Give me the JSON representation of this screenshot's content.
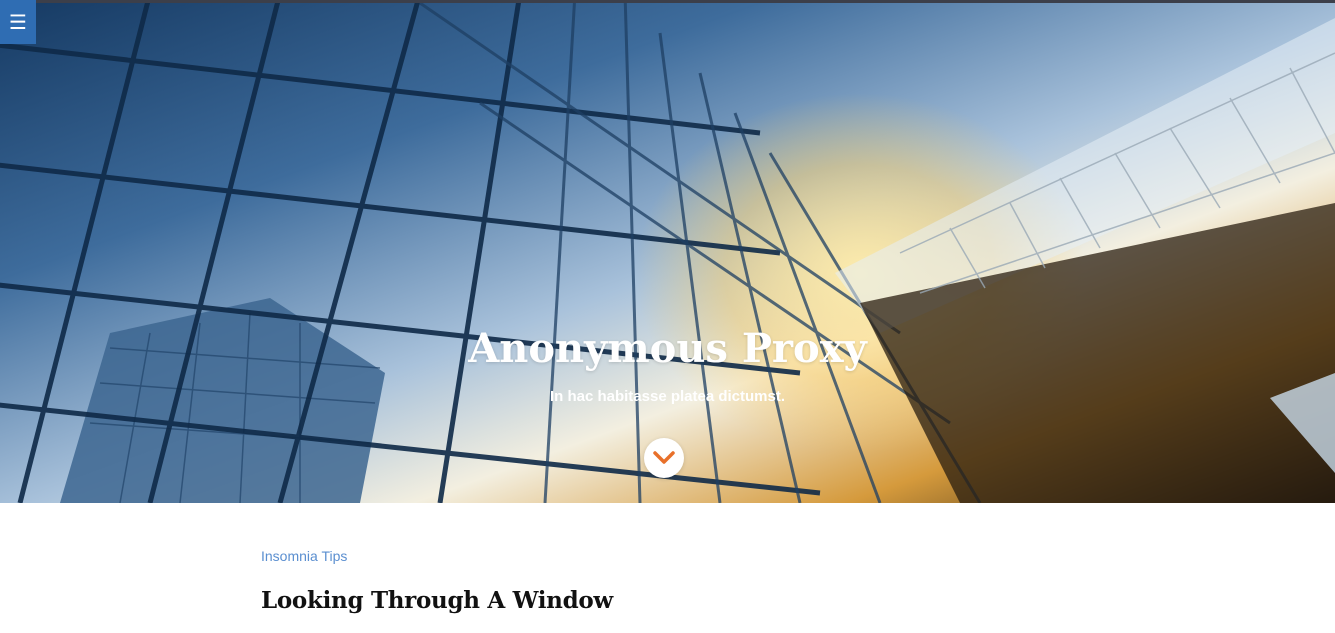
{
  "menu": {
    "icon": "hamburger-menu-icon",
    "glyph": "☰"
  },
  "hero": {
    "title": "Anonymous Proxy",
    "subtitle": "In hac habitasse platea dictumst.",
    "scroll_icon": "chevron-down-icon"
  },
  "post": {
    "category": "Insomnia Tips",
    "title": "Looking Through A Window"
  },
  "colors": {
    "menu_background": "#2f6db3",
    "accent": "#e8702a",
    "category_link": "#5b8fd0",
    "title_text": "#111111"
  }
}
